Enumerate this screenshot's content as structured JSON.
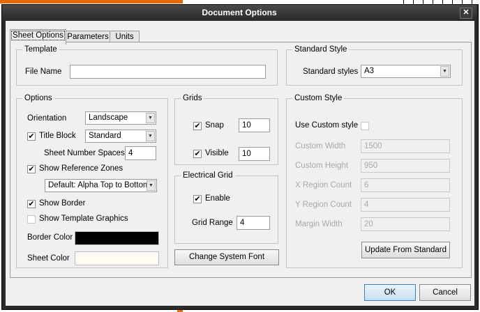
{
  "window": {
    "title": "Document Options"
  },
  "tabs": [
    "Sheet Options",
    "Parameters",
    "Units"
  ],
  "template": {
    "group_label": "Template",
    "file_name_label": "File Name",
    "file_name_value": ""
  },
  "standard_style": {
    "group_label": "Standard Style",
    "styles_label": "Standard styles",
    "styles_value": "A3"
  },
  "options": {
    "group_label": "Options",
    "orientation_label": "Orientation",
    "orientation_value": "Landscape",
    "title_block_label": "Title Block",
    "title_block_checked": true,
    "title_block_value": "Standard",
    "sheet_number_spaces_label": "Sheet Number Spaces",
    "sheet_number_spaces_value": "4",
    "show_reference_zones_label": "Show Reference Zones",
    "show_reference_zones_checked": true,
    "reference_zones_value": "Default: Alpha Top to Bottom,",
    "show_border_label": "Show Border",
    "show_border_checked": true,
    "show_template_graphics_label": "Show Template Graphics",
    "show_template_graphics_checked": false,
    "border_color_label": "Border Color",
    "border_color": "#000000",
    "sheet_color_label": "Sheet Color",
    "sheet_color": "#fffaf2"
  },
  "grids": {
    "group_label": "Grids",
    "snap_label": "Snap",
    "snap_checked": true,
    "snap_value": "10",
    "visible_label": "Visible",
    "visible_checked": true,
    "visible_value": "10"
  },
  "electrical_grid": {
    "group_label": "Electrical Grid",
    "enable_label": "Enable",
    "enable_checked": true,
    "grid_range_label": "Grid Range",
    "grid_range_value": "4"
  },
  "change_font_button": "Change System Font",
  "custom_style": {
    "group_label": "Custom Style",
    "use_custom_label": "Use Custom style",
    "use_custom_checked": false,
    "custom_width_label": "Custom Width",
    "custom_width_value": "1500",
    "custom_height_label": "Custom Height",
    "custom_height_value": "950",
    "x_region_label": "X Region Count",
    "x_region_value": "6",
    "y_region_label": "Y Region Count",
    "y_region_value": "4",
    "margin_width_label": "Margin Width",
    "margin_width_value": "20",
    "update_button": "Update From Standard"
  },
  "footer": {
    "ok_button": "OK",
    "cancel_button": "Cancel"
  },
  "icons": {
    "check": "✔",
    "dropdown": "▼",
    "close": "✕"
  }
}
